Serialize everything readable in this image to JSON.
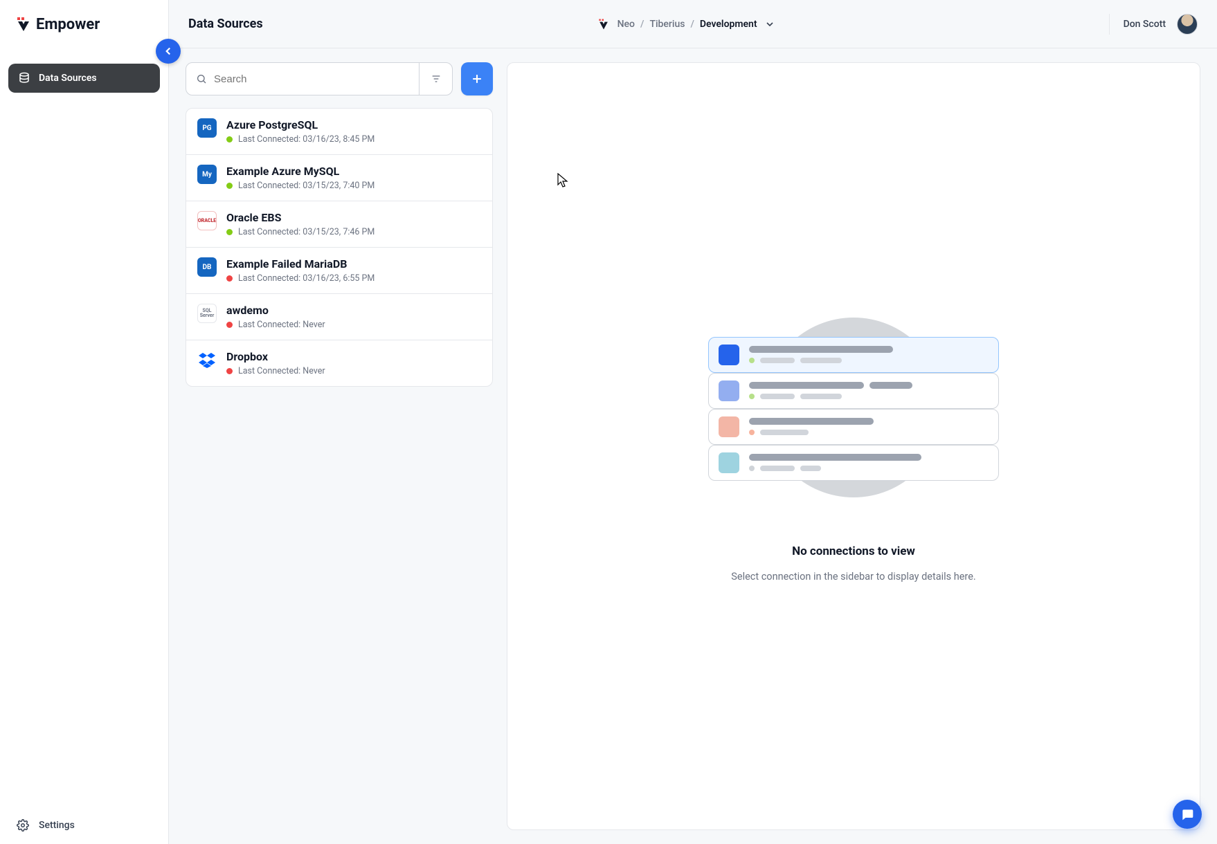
{
  "brand": {
    "name": "Empower"
  },
  "sidebar": {
    "items": [
      {
        "label": "Data Sources"
      }
    ],
    "footer_label": "Settings"
  },
  "header": {
    "title": "Data Sources",
    "breadcrumb": {
      "org": "Neo",
      "project": "Tiberius",
      "env": "Development"
    },
    "user": {
      "name": "Don Scott"
    }
  },
  "search": {
    "placeholder": "Search",
    "value": ""
  },
  "data_sources": [
    {
      "name": "Azure PostgreSQL",
      "status": "ok",
      "last_connected": "Last Connected: 03/16/23, 8:45 PM",
      "icon": "azure-pg",
      "icon_label": "PG"
    },
    {
      "name": "Example Azure MySQL",
      "status": "ok",
      "last_connected": "Last Connected: 03/15/23, 7:40 PM",
      "icon": "azure-my",
      "icon_label": "My"
    },
    {
      "name": "Oracle EBS",
      "status": "ok",
      "last_connected": "Last Connected: 03/15/23, 7:46 PM",
      "icon": "oracle",
      "icon_label": "ORACLE"
    },
    {
      "name": "Example Failed MariaDB",
      "status": "bad",
      "last_connected": "Last Connected: 03/16/23, 6:55 PM",
      "icon": "mariadb",
      "icon_label": "DB"
    },
    {
      "name": "awdemo",
      "status": "bad",
      "last_connected": "Last Connected: Never",
      "icon": "sqlserver",
      "icon_label": "SQL Server"
    },
    {
      "name": "Dropbox",
      "status": "bad",
      "last_connected": "Last Connected: Never",
      "icon": "dropbox",
      "icon_label": ""
    }
  ],
  "empty_state": {
    "title": "No connections to view",
    "subtitle": "Select connection in the sidebar to display details here."
  }
}
